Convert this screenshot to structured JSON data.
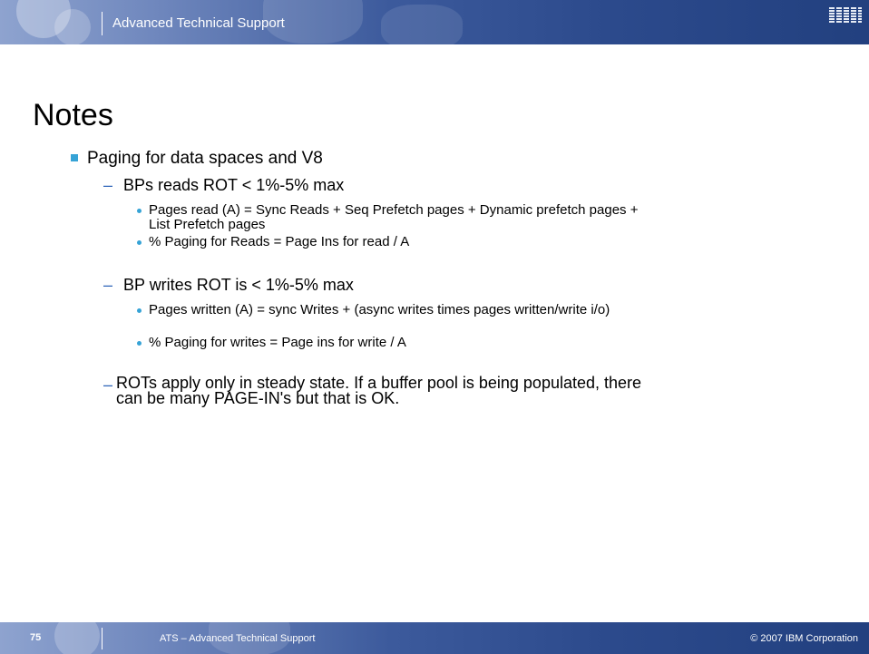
{
  "header": {
    "title": "Advanced Technical Support",
    "logo": "IBM"
  },
  "slide": {
    "title": "Notes",
    "bullet1": "Paging for data spaces and V8",
    "reads": {
      "heading": "BPs  reads ROT  < 1%-5% max",
      "items": [
        "Pages read (A) = Sync Reads + Seq Prefetch pages + Dynamic prefetch pages + List Prefetch pages",
        "% Paging for Reads = Page Ins for read / A"
      ]
    },
    "writes": {
      "heading": "BP writes ROT is < 1%-5% max",
      "items": [
        "Pages written (A)  = sync Writes + (async writes times pages written/write i/o)",
        "% Paging for writes = Page ins for write / A"
      ]
    },
    "steady_state": " ROTs apply only in steady state. If a buffer pool is being populated, there can be many PAGE-IN's but that is OK."
  },
  "footer": {
    "page_number": "75",
    "text": "ATS – Advanced Technical Support",
    "copyright": "© 2007 IBM Corporation"
  },
  "colors": {
    "accent": "#36a3d6",
    "dash": "#2e64b8",
    "band": "#2c4a8c"
  }
}
